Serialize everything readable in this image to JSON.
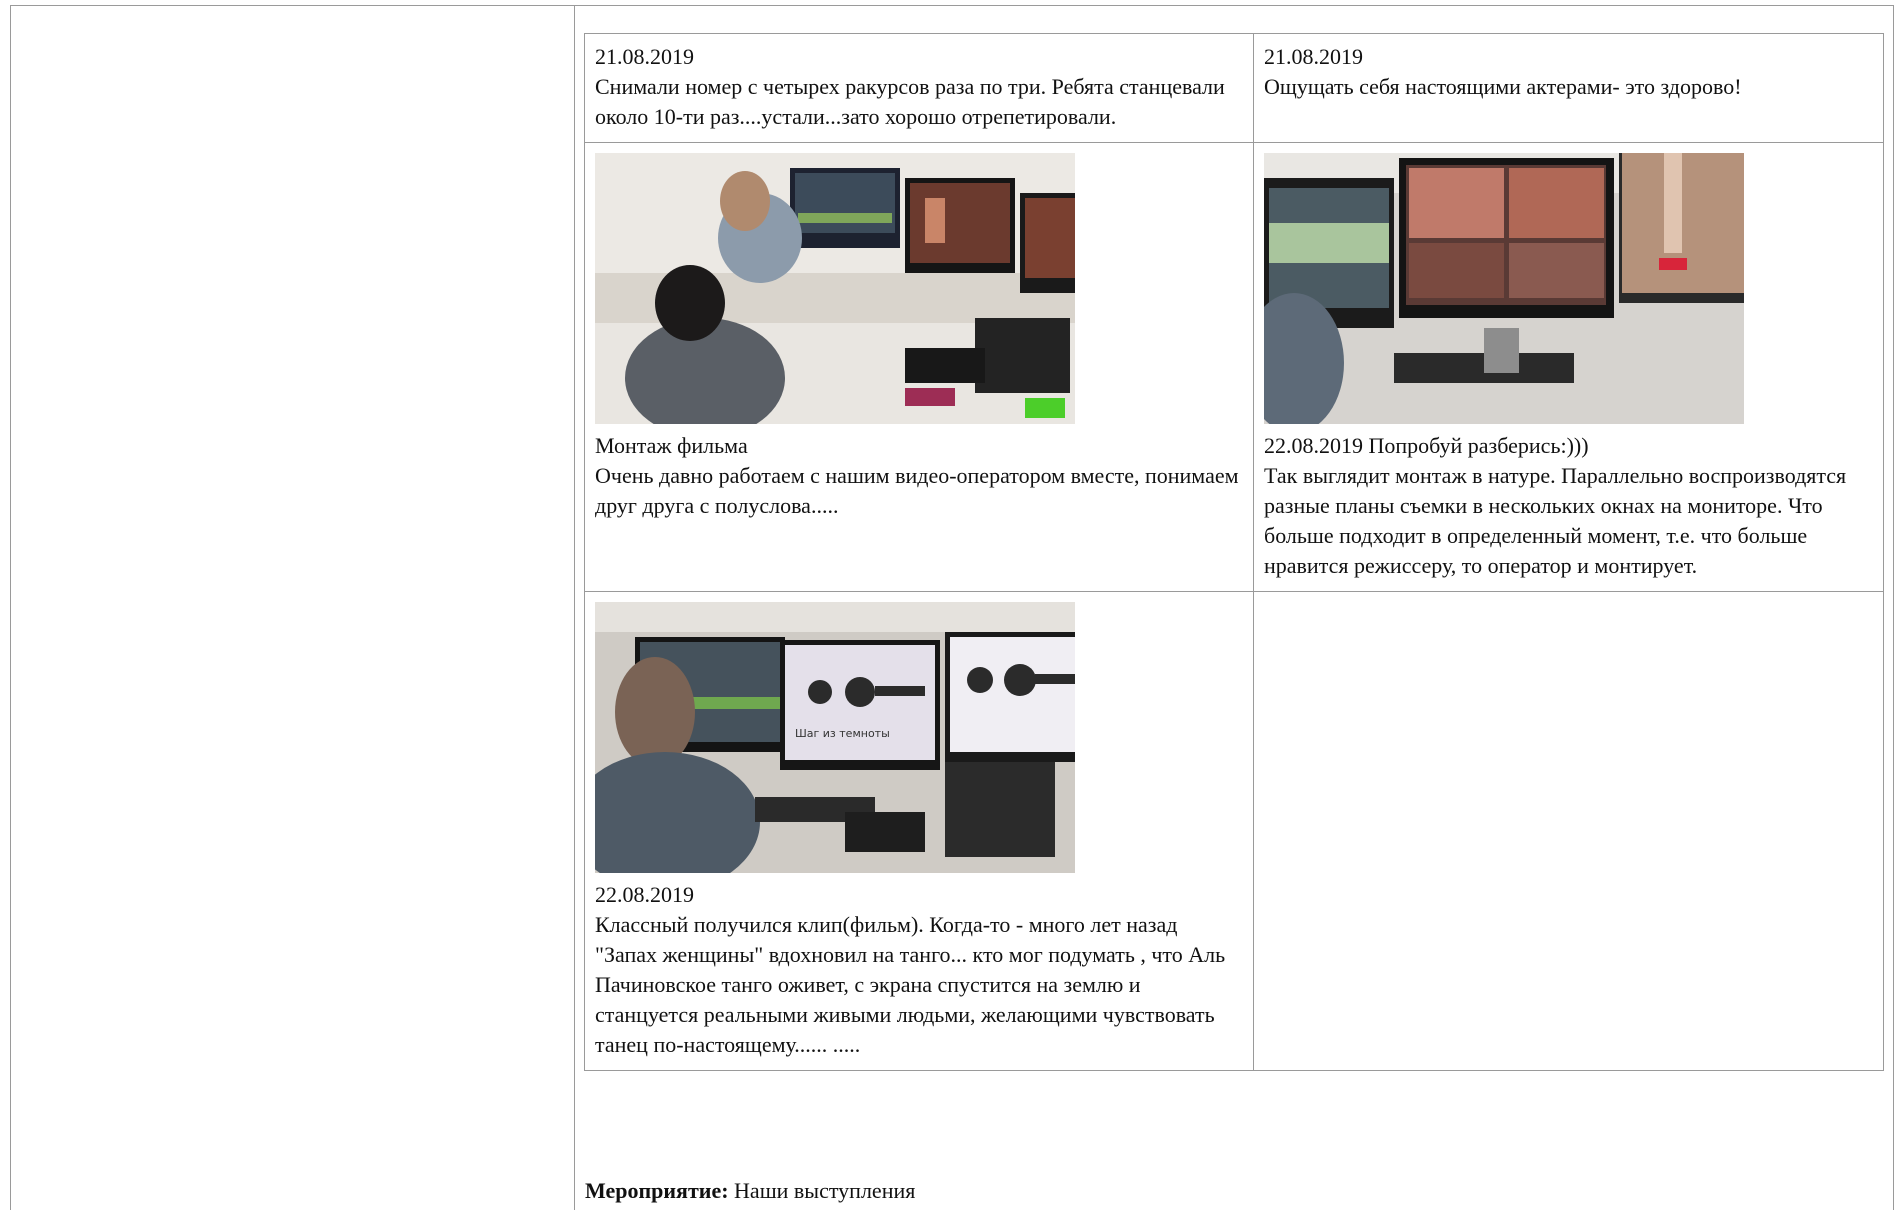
{
  "cards": [
    {
      "date": "21.08.2019",
      "text": "Снимали номер с четырех ракурсов раза по три. Ребята станцевали около 10-ти раз....устали...зато хорошо отрепетировали."
    },
    {
      "date": "21.08.2019",
      "text": "Ощущать себя настоящими актерами- это здорово!"
    },
    {
      "photo": "editing-studio-photo",
      "caption": "Монтаж фильма",
      "text": "Очень давно работаем с нашим видео-оператором вместе, понимаем друг друга с полуслова....."
    },
    {
      "photo": "editing-monitors-photo",
      "caption": "22.08.2019 Попробуй разберись:)))",
      "text": "Так выглядит монтаж в натуре. Параллельно воспроизводятся разные планы съемки в нескольких окнах на мониторе. Что больше подходит в определенный момент, т.е. что больше нравится режиссеру, то оператор и монтирует."
    },
    {
      "photo": "film-title-photo",
      "caption": "22.08.2019",
      "text": "Классный получился клип(фильм). Когда-то - много лет назад \"Запах женщины\" вдохновил на танго... кто мог подумать , что Аль Пачиновское танго оживет, с экрана спустится на землю и станцуется реальными живыми людьми, желающими чувствовать танец по-настоящему...... .....",
      "photo_logo_text": "Шаг из темноты"
    }
  ],
  "event": {
    "label": "Мероприятие:",
    "value": "Наши выступления"
  }
}
